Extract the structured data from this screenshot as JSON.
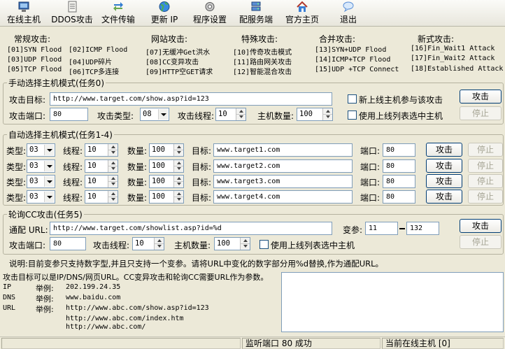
{
  "toolbar": {
    "items": [
      "在线主机",
      "DDOS攻击",
      "文件传输",
      "更新 IP",
      "程序设置",
      "配服务端",
      "官方主页",
      "退出"
    ]
  },
  "categories": {
    "normal": {
      "title": "常规攻击:",
      "items": [
        "[01]SYN Flood",
        "[02]ICMP Flood",
        "[03]UDP Flood",
        "[04]UDP碎片",
        "[05]TCP Flood",
        "[06]TCP多连接"
      ]
    },
    "web": {
      "title": "网站攻击:",
      "items": [
        "[07]无缓冲Get洪水",
        "[08]CC变异攻击",
        "[09]HTTP空GET请求"
      ]
    },
    "special": {
      "title": "特殊攻击:",
      "items": [
        "[10]传奇攻击模式",
        "[11]路由网关攻击",
        "[12]智能混合攻击"
      ]
    },
    "combined": {
      "title": "合并攻击:",
      "items": [
        "[13]SYN+UDP Flood",
        "[14]ICMP+TCP Flood",
        "[15]UDP +TCP Connect"
      ]
    },
    "new": {
      "title": "新式攻击:",
      "items": [
        "[16]Fin_Wait1 Attack",
        "[17]Fin_Wait2 Attack",
        "[18]Established Attack"
      ]
    }
  },
  "manual": {
    "title": "手动选择主机模式(任务0)",
    "target_label": "攻击目标:",
    "target": "http://www.target.com/show.asp?id=123",
    "port_label": "攻击端口:",
    "port": "80",
    "type_label": "攻击类型:",
    "type": "08",
    "threads_label": "攻击线程:",
    "threads": "10",
    "hosts_label": "主机数量:",
    "hosts": "100",
    "new_host_label": "新上线主机参与该攻击",
    "use_list_label": "使用上线列表选中主机",
    "attack": "攻击",
    "stop": "停止"
  },
  "auto": {
    "title": "自动选择主机模式(任务1-4)",
    "type_label": "类型:",
    "threads_label": "线程:",
    "count_label": "数量:",
    "target_label": "目标:",
    "port_label": "端口:",
    "attack": "攻击",
    "stop": "停止",
    "rows": [
      {
        "type": "03",
        "threads": "10",
        "count": "100",
        "target": "www.target1.com",
        "port": "80"
      },
      {
        "type": "03",
        "threads": "10",
        "count": "100",
        "target": "www.target2.com",
        "port": "80"
      },
      {
        "type": "03",
        "threads": "10",
        "count": "100",
        "target": "www.target3.com",
        "port": "80"
      },
      {
        "type": "03",
        "threads": "10",
        "count": "100",
        "target": "www.target4.com",
        "port": "80"
      }
    ]
  },
  "cc": {
    "title": "轮询CC攻击(任务5)",
    "url_label": "通配 URL:",
    "url": "http://www.target.com/showlist.asp?id=%d",
    "var_label": "变参:",
    "var_from": "11",
    "var_to": "132",
    "port_label": "攻击端口:",
    "port": "80",
    "threads_label": "攻击线程:",
    "threads": "10",
    "hosts_label": "主机数量:",
    "hosts": "100",
    "use_list_label": "使用上线列表选中主机",
    "attack": "攻击",
    "stop": "停止",
    "note": "说明:目前变参只支持数字型,并且只支持一个变参。请将URL中变化的数字部分用%d替换,作为通配URL。"
  },
  "help": {
    "line1": "攻击目标可以是IP/DNS/网页URL。CC变异攻击和轮询CC需要URL作为参数。",
    "examples": [
      {
        "kind": "IP",
        "label": "举例:",
        "value": "202.199.24.35"
      },
      {
        "kind": "DNS",
        "label": "举例:",
        "value": "www.baidu.com"
      },
      {
        "kind": "URL",
        "label": "举例:",
        "value": "http://www.abc.com/show.asp?id=123"
      }
    ],
    "extra": [
      "http://www.abc.com/index.htm",
      "http://www.abc.com/"
    ]
  },
  "status": {
    "listen": "监听端口 80 成功",
    "online": "当前在线主机 [0]"
  }
}
